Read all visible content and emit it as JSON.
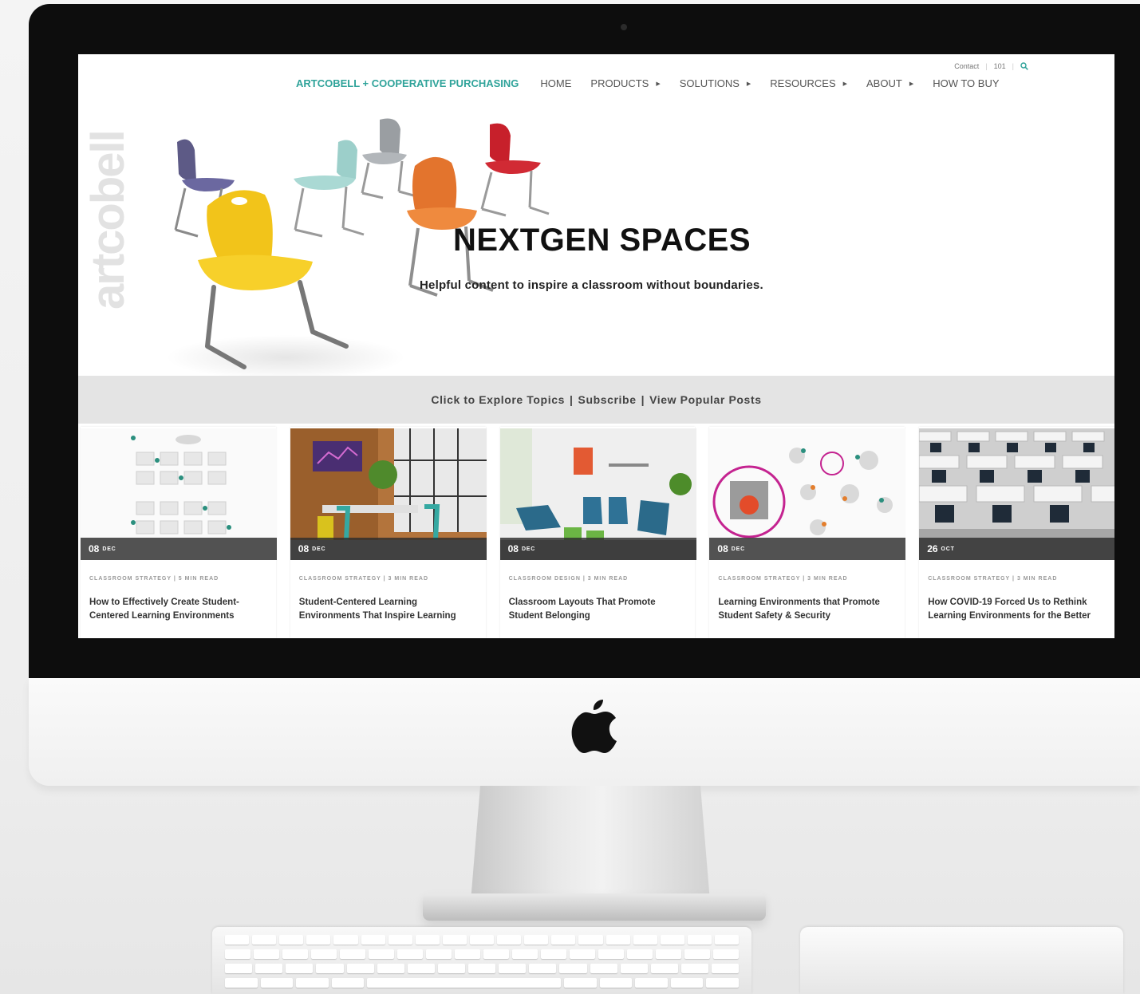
{
  "site": {
    "logo_vertical": "artcobell",
    "utility": {
      "contact": "Contact",
      "page_number": "101"
    },
    "brand_link": "ARTCOBELL + COOPERATIVE PURCHASING",
    "nav": [
      {
        "label": "HOME",
        "has_dropdown": false
      },
      {
        "label": "PRODUCTS",
        "has_dropdown": true
      },
      {
        "label": "SOLUTIONS",
        "has_dropdown": true
      },
      {
        "label": "RESOURCES",
        "has_dropdown": true
      },
      {
        "label": "ABOUT",
        "has_dropdown": true
      },
      {
        "label": "HOW TO BUY",
        "has_dropdown": false
      }
    ]
  },
  "hero": {
    "title": "NEXTGEN SPACES",
    "subtitle": "Helpful content to inspire a classroom without boundaries."
  },
  "explore": {
    "topics": "Click to Explore Topics",
    "subscribe": "Subscribe",
    "popular": "View Popular Posts",
    "separator": "|"
  },
  "cards": [
    {
      "day": "08",
      "month": "DEC",
      "meta": "CLASSROOM STRATEGY | 5 MIN READ",
      "title": "How to Effectively Create Student-Centered Learning Environments"
    },
    {
      "day": "08",
      "month": "DEC",
      "meta": "CLASSROOM STRATEGY | 3 MIN READ",
      "title": "Student-Centered Learning Environments That Inspire Learning"
    },
    {
      "day": "08",
      "month": "DEC",
      "meta": "CLASSROOM DESIGN | 3 MIN READ",
      "title": "Classroom Layouts That Promote Student Belonging"
    },
    {
      "day": "08",
      "month": "DEC",
      "meta": "CLASSROOM STRATEGY | 3 MIN READ",
      "title": "Learning Environments that Promote Student Safety & Security"
    },
    {
      "day": "26",
      "month": "OCT",
      "meta": "CLASSROOM STRATEGY | 3 MIN READ",
      "title": "How COVID-19 Forced Us to Rethink Learning Environments for the Better"
    }
  ],
  "colors": {
    "brand_teal": "#2fa39a",
    "date_bar": "#2d2d2d",
    "explore_bg": "#e4e4e4",
    "bezel": "#0d0d0d"
  }
}
